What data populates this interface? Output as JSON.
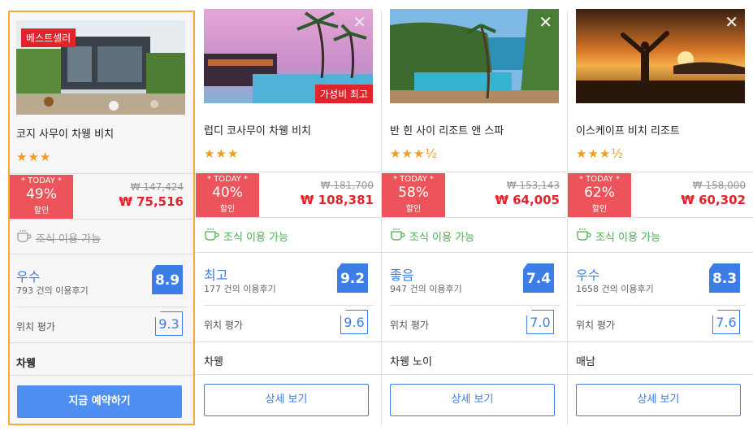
{
  "hotels": [
    {
      "badge": "베스트셀러",
      "name": "코지 사무이 차웽 비치",
      "stars": "★★★",
      "today": "* TODAY *",
      "discount": "49%",
      "discount_label": "할인",
      "original_price": "₩ 147,424",
      "price": "₩ 75,516",
      "breakfast": "조식 이용 가능",
      "breakfast_available": false,
      "score_label": "우수",
      "reviews": "793 건의 이용후기",
      "score": "8.9",
      "location_label": "위치 평가",
      "location_score": "9.3",
      "area": "차웽",
      "button": "지금 예약하기"
    },
    {
      "badge": "가성비 최고",
      "name": "럽디 코사무이 차웽 비치",
      "stars": "★★★",
      "today": "* TODAY *",
      "discount": "40%",
      "discount_label": "할인",
      "original_price": "₩ 181,700",
      "price": "₩ 108,381",
      "breakfast": "조식 이용 가능",
      "breakfast_available": true,
      "score_label": "최고",
      "reviews": "177 건의 이용후기",
      "score": "9.2",
      "location_label": "위치 평가",
      "location_score": "9.6",
      "area": "차웽",
      "button": "상세 보기"
    },
    {
      "name": "반 힌 사이 리조트 앤 스파",
      "stars": "★★★½",
      "today": "* TODAY *",
      "discount": "58%",
      "discount_label": "할인",
      "original_price": "₩ 153,143",
      "price": "₩ 64,005",
      "breakfast": "조식 이용 가능",
      "breakfast_available": true,
      "score_label": "좋음",
      "reviews": "947 건의 이용후기",
      "score": "7.4",
      "location_label": "위치 평가",
      "location_score": "7.0",
      "area": "차웽 노이",
      "button": "상세 보기"
    },
    {
      "name": "이스케이프 비치 리조트",
      "stars": "★★★½",
      "today": "* TODAY *",
      "discount": "62%",
      "discount_label": "할인",
      "original_price": "₩ 158,000",
      "price": "₩ 60,302",
      "breakfast": "조식 이용 가능",
      "breakfast_available": true,
      "score_label": "우수",
      "reviews": "1658 건의 이용후기",
      "score": "8.3",
      "location_label": "위치 평가",
      "location_score": "7.6",
      "area": "매남",
      "button": "상세 보기"
    }
  ],
  "close_glyph": "✕",
  "colors": {
    "accent": "#3d7ee6",
    "sale_red": "#e0242c",
    "today_bg": "#ec535b",
    "highlight": "#f4a93b",
    "star": "#f29b1f",
    "breakfast_green": "#4caf50"
  }
}
